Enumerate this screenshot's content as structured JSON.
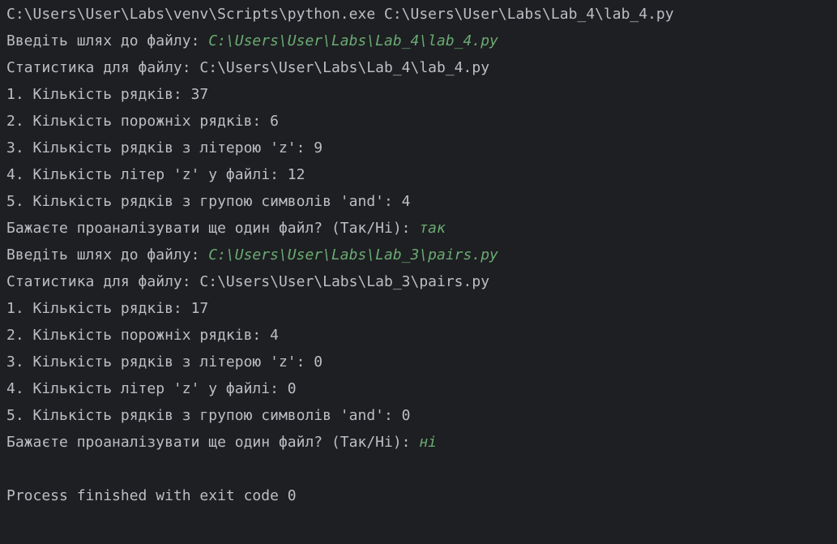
{
  "console": {
    "command": "C:\\Users\\User\\Labs\\venv\\Scripts\\python.exe C:\\Users\\User\\Labs\\Lab_4\\lab_4.py",
    "session1": {
      "path_prompt": "Введіть шлях до файлу: ",
      "path_input": "C:\\Users\\User\\Labs\\Lab_4\\lab_4.py",
      "stats_header": "Статистика для файлу: C:\\Users\\User\\Labs\\Lab_4\\lab_4.py",
      "stat1": "1. Кількість рядків: 37",
      "stat2": "2. Кількість порожніх рядків: 6",
      "stat3": "3. Кількість рядків з літерою 'z': 9",
      "stat4": "4. Кількість літер 'z' у файлі: 12",
      "stat5": "5. Кількість рядків з групою символів 'and': 4",
      "again_prompt": "Бажаєте проаналізувати ще один файл? (Так/Ні): ",
      "again_input": "так"
    },
    "session2": {
      "path_prompt": "Введіть шлях до файлу: ",
      "path_input": "C:\\Users\\User\\Labs\\Lab_3\\pairs.py",
      "stats_header": "Статистика для файлу: C:\\Users\\User\\Labs\\Lab_3\\pairs.py",
      "stat1": "1. Кількість рядків: 17",
      "stat2": "2. Кількість порожніх рядків: 4",
      "stat3": "3. Кількість рядків з літерою 'z': 0",
      "stat4": "4. Кількість літер 'z' у файлі: 0",
      "stat5": "5. Кількість рядків з групою символів 'and': 0",
      "again_prompt": "Бажаєте проаналізувати ще один файл? (Так/Ні): ",
      "again_input": "ні"
    },
    "exit_message": "Process finished with exit code 0"
  },
  "colors": {
    "background": "#1e1f22",
    "text": "#bcbec4",
    "user_input": "#6aab73"
  }
}
